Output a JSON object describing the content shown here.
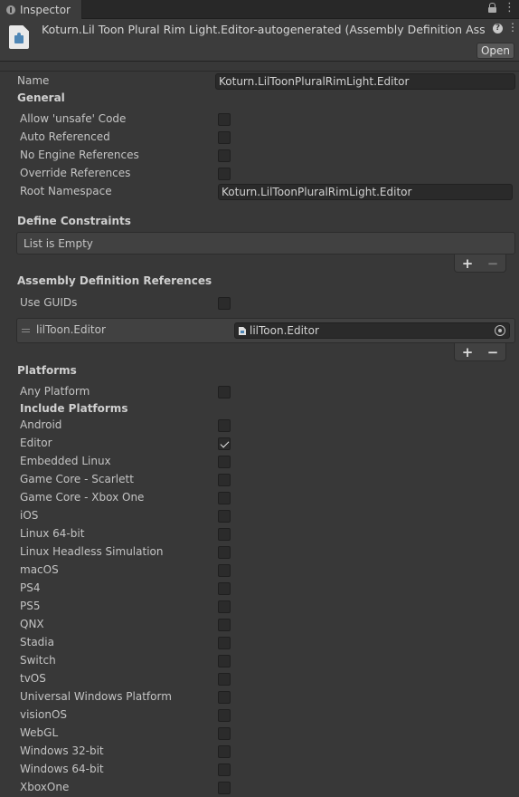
{
  "tab": {
    "label": "Inspector"
  },
  "header": {
    "title": "Koturn.Lil Toon Plural Rim Light.Editor-autogenerated (Assembly Definition Asset)",
    "open_label": "Open"
  },
  "name_field": {
    "label": "Name",
    "value": "Koturn.LilToonPluralRimLight.Editor"
  },
  "general": {
    "heading": "General",
    "allow_unsafe": {
      "label": "Allow 'unsafe' Code",
      "checked": false
    },
    "auto_referenced": {
      "label": "Auto Referenced",
      "checked": false
    },
    "no_engine_references": {
      "label": "No Engine References",
      "checked": false
    },
    "override_references": {
      "label": "Override References",
      "checked": false
    },
    "root_namespace": {
      "label": "Root Namespace",
      "value": "Koturn.LilToonPluralRimLight.Editor"
    }
  },
  "define_constraints": {
    "heading": "Define Constraints",
    "empty_text": "List is Empty",
    "add": "+",
    "remove": "−"
  },
  "assembly_refs": {
    "heading": "Assembly Definition References",
    "use_guids": {
      "label": "Use GUIDs",
      "checked": false
    },
    "items": [
      {
        "label": "lilToon.Editor",
        "value": "lilToon.Editor"
      }
    ],
    "add": "+",
    "remove": "−"
  },
  "platforms": {
    "heading": "Platforms",
    "any_platform": {
      "label": "Any Platform",
      "checked": false
    },
    "include_heading": "Include Platforms",
    "list": [
      {
        "label": "Android",
        "checked": false
      },
      {
        "label": "Editor",
        "checked": true
      },
      {
        "label": "Embedded Linux",
        "checked": false
      },
      {
        "label": "Game Core - Scarlett",
        "checked": false
      },
      {
        "label": "Game Core - Xbox One",
        "checked": false
      },
      {
        "label": "iOS",
        "checked": false
      },
      {
        "label": "Linux 64-bit",
        "checked": false
      },
      {
        "label": "Linux Headless Simulation",
        "checked": false
      },
      {
        "label": "macOS",
        "checked": false
      },
      {
        "label": "PS4",
        "checked": false
      },
      {
        "label": "PS5",
        "checked": false
      },
      {
        "label": "QNX",
        "checked": false
      },
      {
        "label": "Stadia",
        "checked": false
      },
      {
        "label": "Switch",
        "checked": false
      },
      {
        "label": "tvOS",
        "checked": false
      },
      {
        "label": "Universal Windows Platform",
        "checked": false
      },
      {
        "label": "visionOS",
        "checked": false
      },
      {
        "label": "WebGL",
        "checked": false
      },
      {
        "label": "Windows 32-bit",
        "checked": false
      },
      {
        "label": "Windows 64-bit",
        "checked": false
      },
      {
        "label": "XboxOne",
        "checked": false
      }
    ]
  }
}
